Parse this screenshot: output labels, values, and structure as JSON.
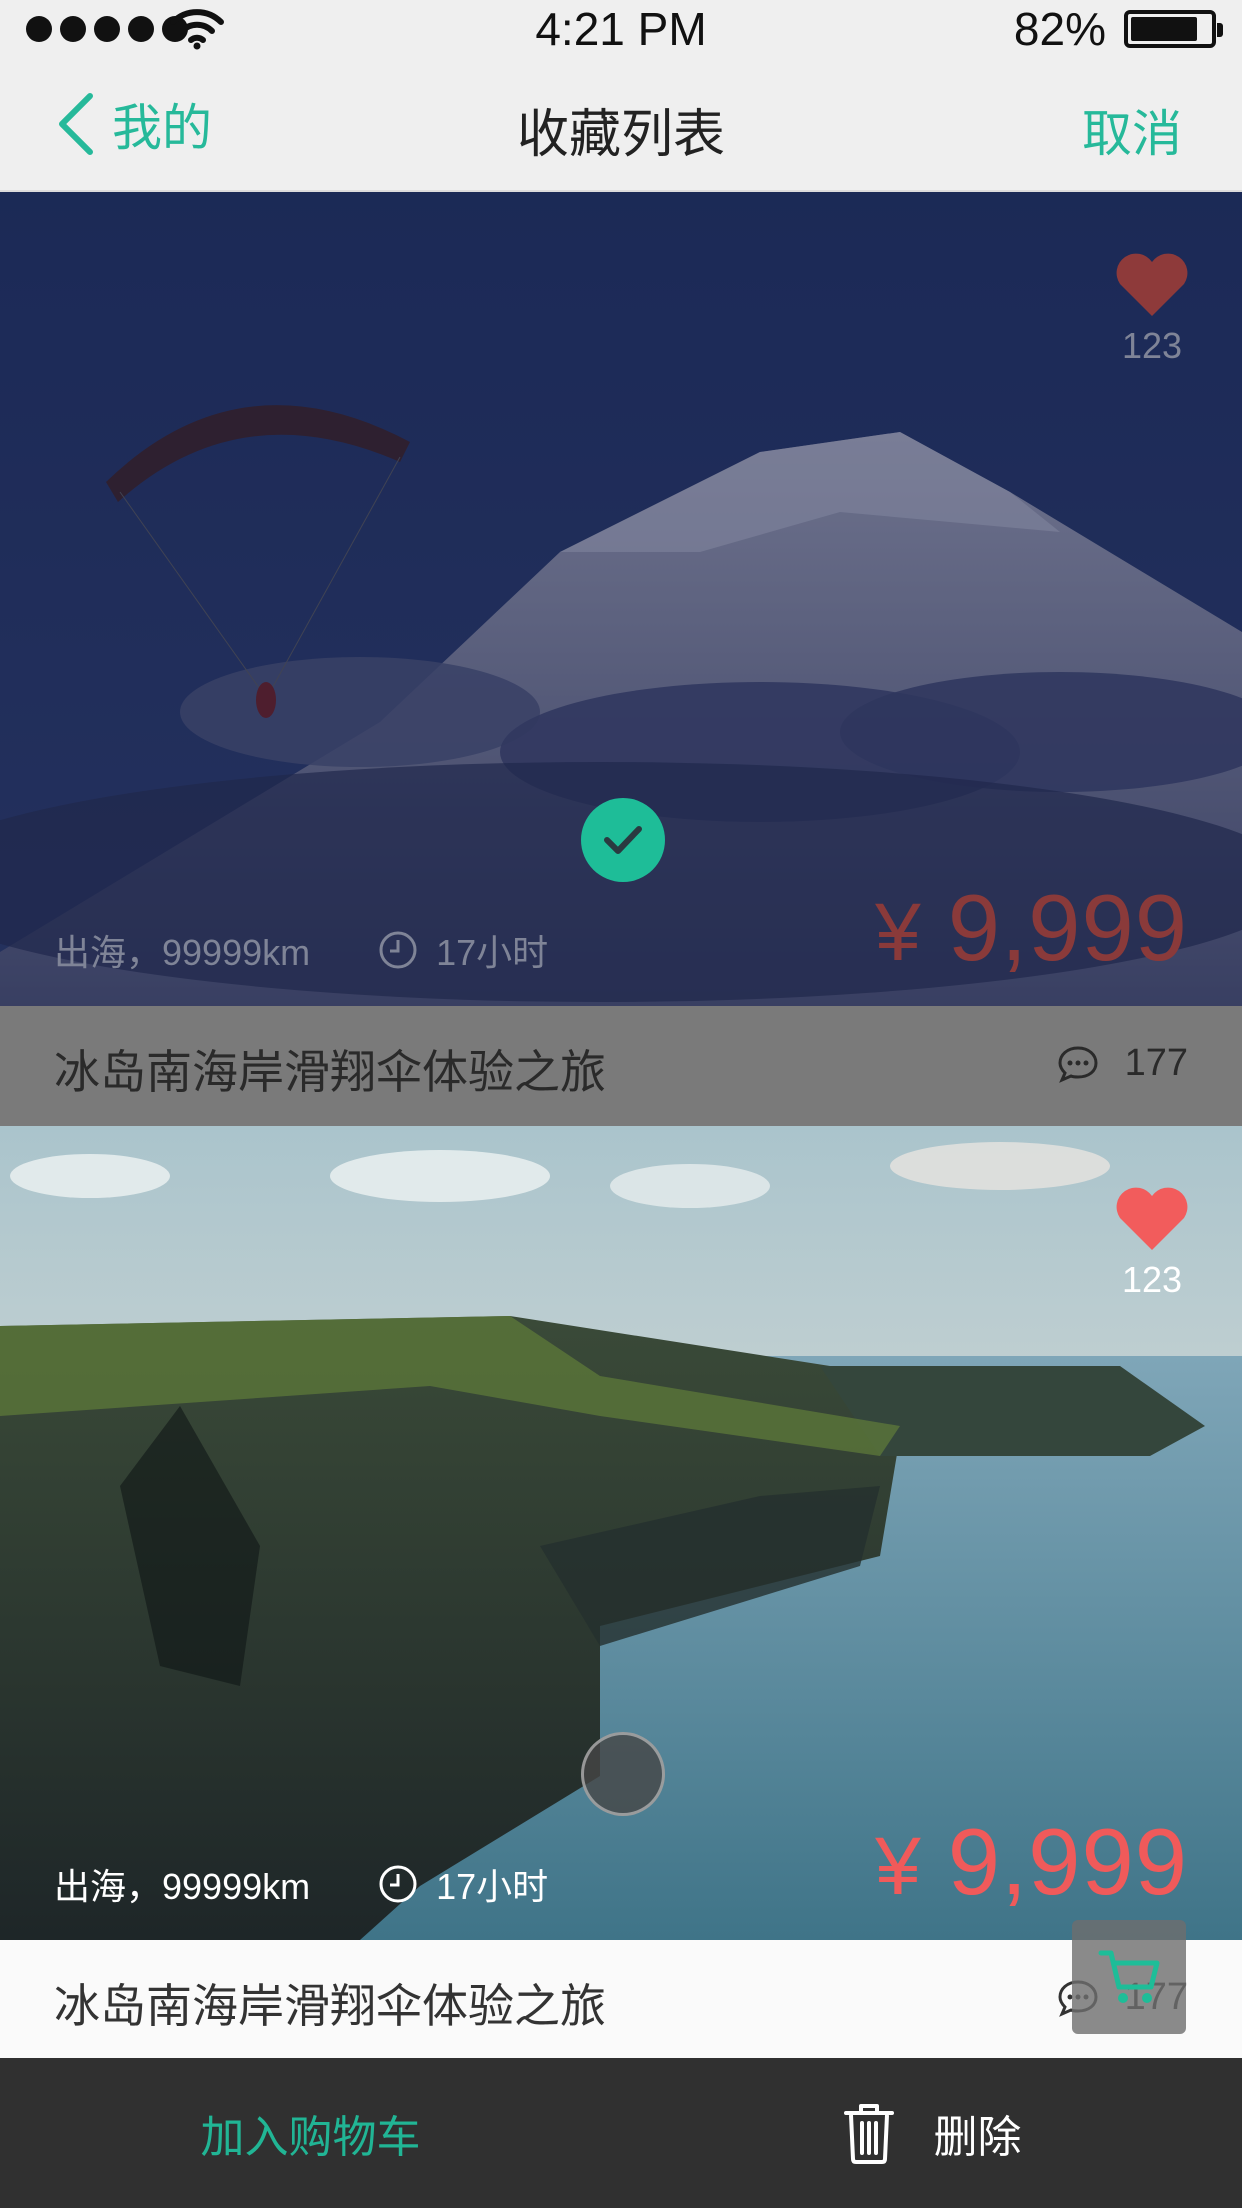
{
  "status_bar": {
    "time": "4:21 PM",
    "battery": "82%"
  },
  "nav": {
    "back_label": "我的",
    "title": "收藏列表",
    "cancel_label": "取消"
  },
  "cards": [
    {
      "likes": "123",
      "meta_location": "出海，99999km",
      "meta_duration": "17小时",
      "currency": "¥",
      "price": "9,999",
      "title": "冰岛南海岸滑翔伞体验之旅",
      "comments": "177",
      "selected": true
    },
    {
      "likes": "123",
      "meta_location": "出海，99999km",
      "meta_duration": "17小时",
      "currency": "¥",
      "price": "9,999",
      "title": "冰岛南海岸滑翔伞体验之旅",
      "comments": "177",
      "selected": false
    }
  ],
  "toolbar": {
    "add_to_cart": "加入购物车",
    "delete": "删除"
  },
  "colors": {
    "accent": "#1ebd98",
    "price": "#f05a5a",
    "heart": "#f25c5c",
    "toolbar_bg": "#303030"
  },
  "icons": [
    "back-chevron-icon",
    "heart-icon",
    "clock-icon",
    "comment-icon",
    "check-icon",
    "cart-icon",
    "trash-icon",
    "wifi-icon",
    "battery-icon"
  ]
}
